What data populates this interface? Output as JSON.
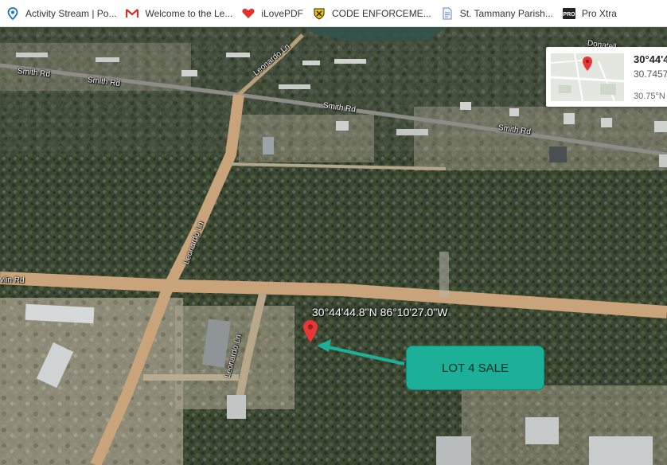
{
  "bookmarks": [
    {
      "label": "Activity Stream | Po...",
      "icon": "activity-stream-icon"
    },
    {
      "label": "Welcome to the Le...",
      "icon": "gmail-icon"
    },
    {
      "label": "iLovePDF",
      "icon": "ilovepdf-icon"
    },
    {
      "label": "CODE ENFORCEME...",
      "icon": "code-enforcement-icon"
    },
    {
      "label": "St. Tammany Parish...",
      "icon": "document-icon"
    },
    {
      "label": "Pro Xtra",
      "icon": "pro-xtra-icon"
    }
  ],
  "map": {
    "roads": {
      "smith_rd_1": "Smith Rd",
      "smith_rd_2": "Smith Rd",
      "smith_rd_3": "Smith Rd",
      "smith_rd_4": "Smith Rd",
      "leonardo_ln_1": "Leonardo Ln",
      "leonardo_ln_2": "Leonardo Ln",
      "leonardo_ln_3": "Leonardo Ln",
      "donatello": "Donatell",
      "wlin_rd": "vlin Rd"
    },
    "pin_coordinates": "30°44'44.8\"N 86°10'27.0\"W",
    "callout": "LOT 4 SALE",
    "callout_color": "#1bb097",
    "pin_color": "#e53935"
  },
  "minimap_card": {
    "line1": "30°44'4",
    "line2": "30.7457",
    "line3": "30.75°N"
  }
}
